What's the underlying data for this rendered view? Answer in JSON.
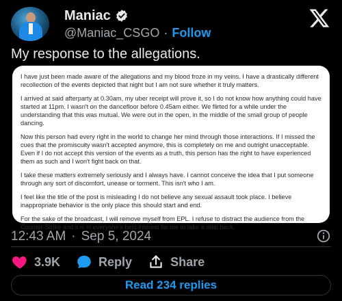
{
  "author": {
    "name": "Maniac",
    "handle": "@Maniac_CSGO",
    "separator": "·",
    "follow_label": "Follow"
  },
  "post": {
    "text": "My response to the allegations.",
    "statement": [
      "I have just been made aware of the allegations and my blood froze in my veins. I have a drastically different recollection of the events depicted that night but I am not sure whether it truly matters.",
      "I arrived at said afterparty at 0.30am, my uber receipt will prove it, so I do not know how anything could have started at 11pm. I wasn't on the dancefloor before 0.45am either. We flirted for a while under the understanding that this was mutual. We were out in the open, in the middle of the small group of people dancing.",
      "Now this person had every right in the world to change her mind through those interactions. If I missed the cues that the promiscuity wasn't accepted anymore, this is completely on me and outright unacceptable. Even if I do not accept this version of the events as a truth, this person has the right to have experienced them as such and I won't fight back on that.",
      "I take these matters extremely seriously and I always have. I cannot conceive the idea that I put someone through any sort of discomfort, unease or torment. This isn't who I am.",
      "I feel like the title of the post is misleading I do not believe any sexual assault took place. I believe inappropriate behavior is the only place this should start and end.",
      "For the sake of the broadcast, I will remove myself from EPL. I refuse to distract the audience from the Counter-Strike and it is in everyone's best interest for me to take a step back."
    ],
    "time": "12:43 AM",
    "date_separator": "·",
    "date": "Sep 5, 2024"
  },
  "actions": {
    "likes": "3.9K",
    "reply_label": "Reply",
    "share_label": "Share"
  },
  "read_replies_label": "Read 234 replies",
  "colors": {
    "accent": "#1d9bf0",
    "like": "#f91880",
    "background": "#000000",
    "text": "#e7e9ea",
    "muted": "#a0a6ab"
  },
  "icons": {
    "verified": "verified-badge-icon",
    "logo": "x-logo-icon",
    "like": "heart-icon",
    "reply": "reply-bubble-icon",
    "share": "share-icon",
    "info": "info-icon"
  }
}
